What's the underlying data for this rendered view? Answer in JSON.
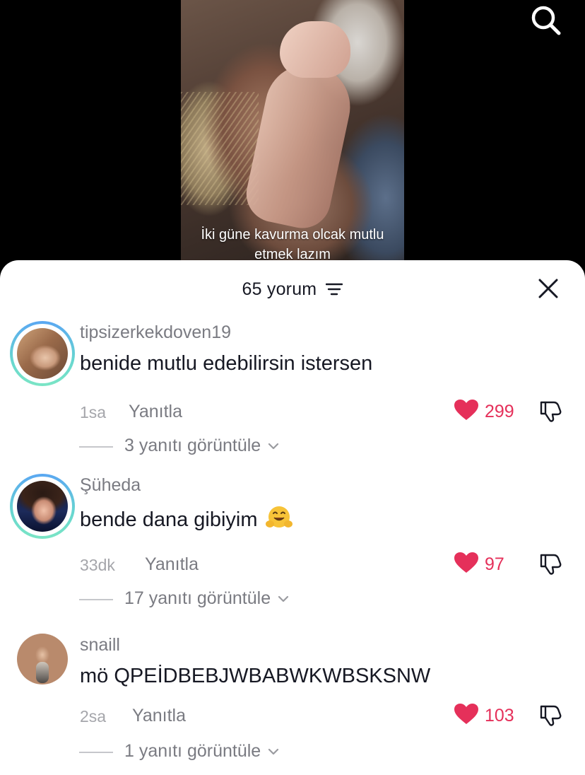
{
  "video": {
    "caption": "İki güne kavurma olcak mutlu etmek lazım"
  },
  "sheet": {
    "title": "65 yorum"
  },
  "comments": [
    {
      "username": "tipsizerkekdoven19",
      "text": "benide mutlu edebilirsin istersen",
      "time": "1sa",
      "reply_label": "Yanıtla",
      "likes": "299",
      "view_replies": "3 yanıtı görüntüle"
    },
    {
      "username": "Şüheda",
      "text": "bende dana gibiyim",
      "time": "33dk",
      "reply_label": "Yanıtla",
      "likes": "97",
      "view_replies": "17 yanıtı görüntüle"
    },
    {
      "username": "snaill",
      "text": "mö QPEİDBEBJWBABWKWBSKSNW",
      "time": "2sa",
      "reply_label": "Yanıtla",
      "likes": "103",
      "view_replies": "1 yanıtı görüntüle"
    }
  ],
  "colors": {
    "like": "#e5305a",
    "avatar_ring_top": "#5aa7f2",
    "avatar_ring_bottom": "#7be5c5",
    "text_primary": "#161823",
    "text_secondary": "#7a7b82"
  },
  "icons": {
    "search": "search-icon",
    "filter": "filter-icon",
    "close": "close-icon",
    "like": "heart-icon",
    "dislike": "thumbs-down-icon",
    "expand": "chevron-down-icon",
    "emoji": "hugging-face-emoji"
  }
}
